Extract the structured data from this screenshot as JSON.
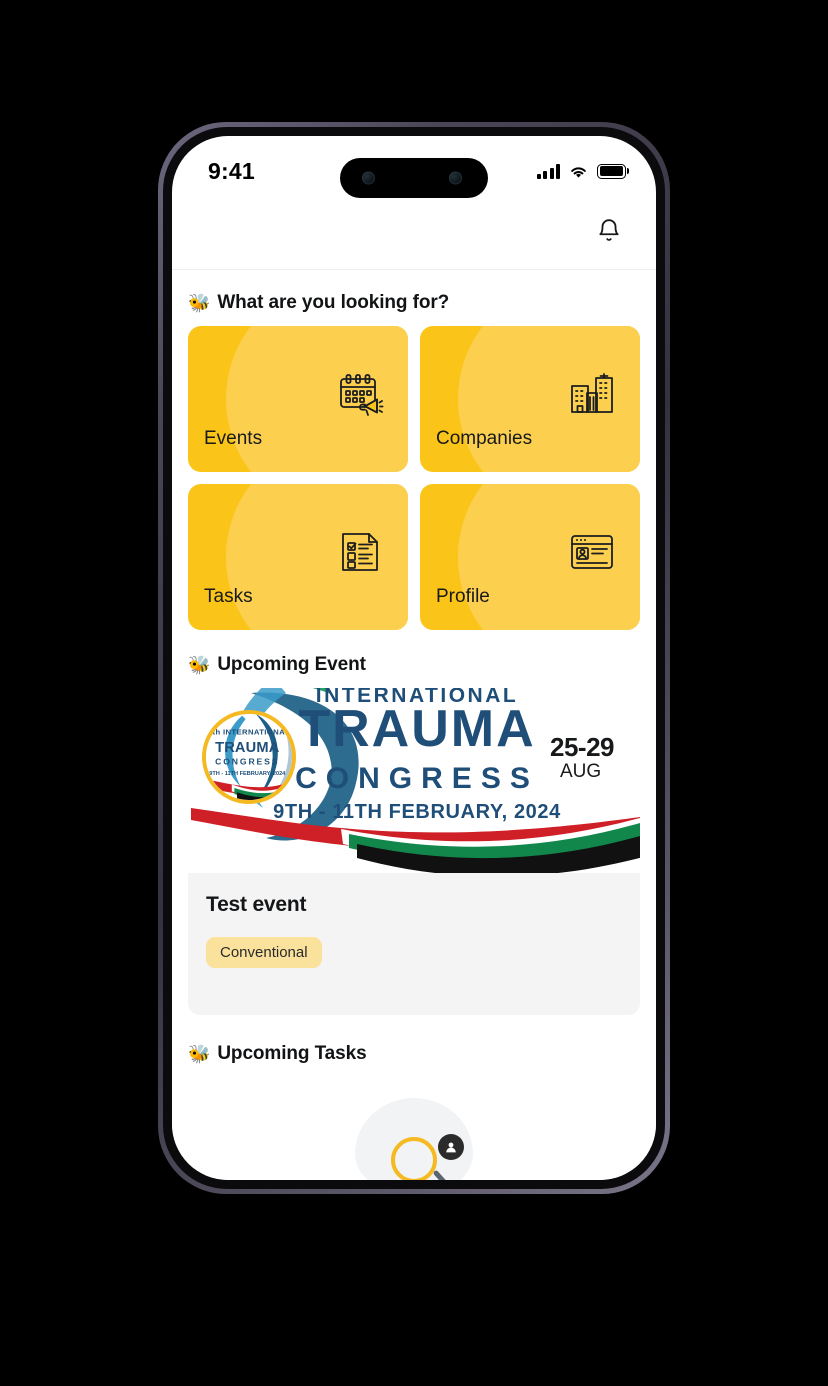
{
  "statusbar": {
    "time": "9:41",
    "signal_icon": "cellular-signal-icon",
    "wifi_icon": "wifi-icon",
    "battery_icon": "battery-full-icon"
  },
  "header": {
    "notifications_icon": "bell-icon"
  },
  "sections": {
    "looking_for": {
      "emoji": "🐝",
      "title": "What are you looking for?"
    },
    "upcoming_event": {
      "emoji": "🐝",
      "title": "Upcoming Event"
    },
    "upcoming_tasks": {
      "emoji": "🐝",
      "title": "Upcoming Tasks"
    }
  },
  "shortcuts": [
    {
      "label": "Events",
      "icon": "calendar-megaphone-icon"
    },
    {
      "label": "Companies",
      "icon": "buildings-icon"
    },
    {
      "label": "Tasks",
      "icon": "checklist-document-icon"
    },
    {
      "label": "Profile",
      "icon": "id-card-icon"
    }
  ],
  "event": {
    "banner_alt": "8th International Trauma Congress",
    "banner_text": {
      "line_top": "INTERNATIONAL",
      "line_main": "TRAUMA",
      "line_sub": "C O N G R E S S",
      "line_date": "9TH - 11TH FEBRUARY, 2024"
    },
    "avatar_alt": "8th International Trauma Congress logo",
    "date_range": "25-29",
    "date_month": "AUG",
    "name": "Test event",
    "badge": "Conventional"
  },
  "bottom_nav": {
    "search_icon": "search-magnifier-icon",
    "profile_icon": "person-avatar-icon"
  },
  "colors": {
    "accent_yellow": "#FBC418",
    "accent_yellow_light": "#FCD04E",
    "badge_bg": "#FBE29C",
    "ring_yellow": "#F5B921",
    "card_bg": "#F4F4F4",
    "text_dark": "#141618"
  }
}
